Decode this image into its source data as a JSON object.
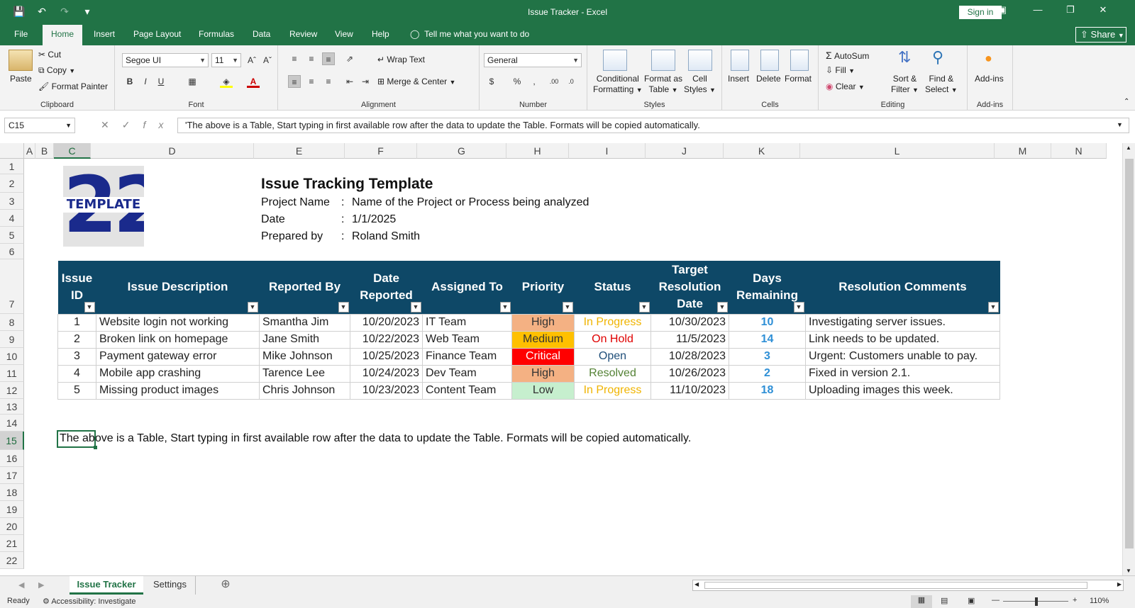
{
  "window": {
    "title": "Issue Tracker  -  Excel",
    "signin": "Sign in",
    "share": "Share"
  },
  "tabs": [
    "File",
    "Home",
    "Insert",
    "Page Layout",
    "Formulas",
    "Data",
    "Review",
    "View",
    "Help"
  ],
  "tell_me": "Tell me what you want to do",
  "ribbon": {
    "clipboard": {
      "label": "Clipboard",
      "paste": "Paste",
      "cut": "Cut",
      "copy": "Copy",
      "format_painter": "Format Painter"
    },
    "font": {
      "label": "Font",
      "name": "Segoe UI",
      "size": "11"
    },
    "alignment": {
      "label": "Alignment",
      "wrap": "Wrap Text",
      "merge": "Merge & Center"
    },
    "number": {
      "label": "Number",
      "format": "General"
    },
    "styles": {
      "label": "Styles",
      "cond1": "Conditional",
      "cond2": "Formatting",
      "fat1": "Format as",
      "fat2": "Table",
      "cs1": "Cell",
      "cs2": "Styles"
    },
    "cells": {
      "label": "Cells",
      "insert": "Insert",
      "delete": "Delete",
      "format": "Format"
    },
    "editing": {
      "label": "Editing",
      "autosum": "AutoSum",
      "fill": "Fill",
      "clear": "Clear",
      "sort1": "Sort &",
      "sort2": "Filter",
      "find1": "Find &",
      "find2": "Select"
    },
    "addins": {
      "label": "Add-ins",
      "btn": "Add-ins"
    }
  },
  "formula_bar": {
    "name_box": "C15",
    "formula": "'The above is a Table, Start typing in first available row after the data to update the Table. Formats will be copied automatically."
  },
  "columns": [
    "A",
    "B",
    "C",
    "D",
    "E",
    "F",
    "G",
    "H",
    "I",
    "J",
    "K",
    "L",
    "M",
    "N"
  ],
  "rows": [
    "1",
    "2",
    "3",
    "4",
    "5",
    "6",
    "7",
    "8",
    "9",
    "10",
    "11",
    "12",
    "13",
    "14",
    "15",
    "16",
    "17",
    "18",
    "19",
    "20",
    "21",
    "22"
  ],
  "sheet": {
    "logo_number": "22",
    "logo_text": "TEMPLATE",
    "title": "Issue Tracking Template",
    "info": [
      {
        "label": "Project Name",
        "sep": ":",
        "value": "Name of the Project or Process being analyzed"
      },
      {
        "label": "Date",
        "sep": ":",
        "value": "1/1/2025"
      },
      {
        "label": "Prepared by",
        "sep": ":",
        "value": "Roland Smith"
      }
    ],
    "table": {
      "headers": [
        [
          "Issue",
          "ID"
        ],
        [
          "Issue Description"
        ],
        [
          "Reported By"
        ],
        [
          "Date",
          "Reported"
        ],
        [
          "Assigned To"
        ],
        [
          "Priority"
        ],
        [
          "Status"
        ],
        [
          "Target",
          "Resolution",
          "Date"
        ],
        [
          "Days",
          "Remaining"
        ],
        [
          "Resolution Comments"
        ]
      ],
      "rows": [
        {
          "id": "1",
          "desc": "Website login not working",
          "by": "Smantha Jim",
          "date": "10/20/2023",
          "assigned": "IT Team",
          "priority": "High",
          "status": "In Progress",
          "target": "10/30/2023",
          "days": "10",
          "comments": "Investigating server issues."
        },
        {
          "id": "2",
          "desc": "Broken link on homepage",
          "by": "Jane Smith",
          "date": "10/22/2023",
          "assigned": "Web Team",
          "priority": "Medium",
          "status": "On Hold",
          "target": "11/5/2023",
          "days": "14",
          "comments": "Link needs to be updated."
        },
        {
          "id": "3",
          "desc": "Payment gateway error",
          "by": "Mike Johnson",
          "date": "10/25/2023",
          "assigned": "Finance Team",
          "priority": "Critical",
          "status": "Open",
          "target": "10/28/2023",
          "days": "3",
          "comments": "Urgent: Customers unable to pay."
        },
        {
          "id": "4",
          "desc": "Mobile app crashing",
          "by": "Tarence Lee",
          "date": "10/24/2023",
          "assigned": "Dev Team",
          "priority": "High",
          "status": "Resolved",
          "target": "10/26/2023",
          "days": "2",
          "comments": "Fixed in version 2.1."
        },
        {
          "id": "5",
          "desc": "Missing product images",
          "by": "Chris Johnson",
          "date": "10/23/2023",
          "assigned": "Content Team",
          "priority": "Low",
          "status": "In Progress",
          "target": "11/10/2023",
          "days": "18",
          "comments": "Uploading images this week."
        }
      ]
    },
    "note": "The above is a Table, Start typing in first available row after the data to update the Table. Formats will be copied automatically."
  },
  "colors": {
    "priority": {
      "High": "#f4b183",
      "Medium": "#ffc000",
      "Critical": "#ff0000",
      "Low": "#c6efce"
    },
    "priority_text": {
      "High": "#333333",
      "Medium": "#333333",
      "Critical": "#ffffff",
      "Low": "#333333"
    },
    "status": {
      "In Progress": "#f0b400",
      "On Hold": "#e00000",
      "Open": "#1f4e79",
      "Resolved": "#548235"
    }
  },
  "sheet_tabs": [
    "Issue Tracker",
    "Settings"
  ],
  "status_bar": {
    "ready": "Ready",
    "accessibility": "Accessibility: Investigate",
    "zoom": "110%"
  }
}
